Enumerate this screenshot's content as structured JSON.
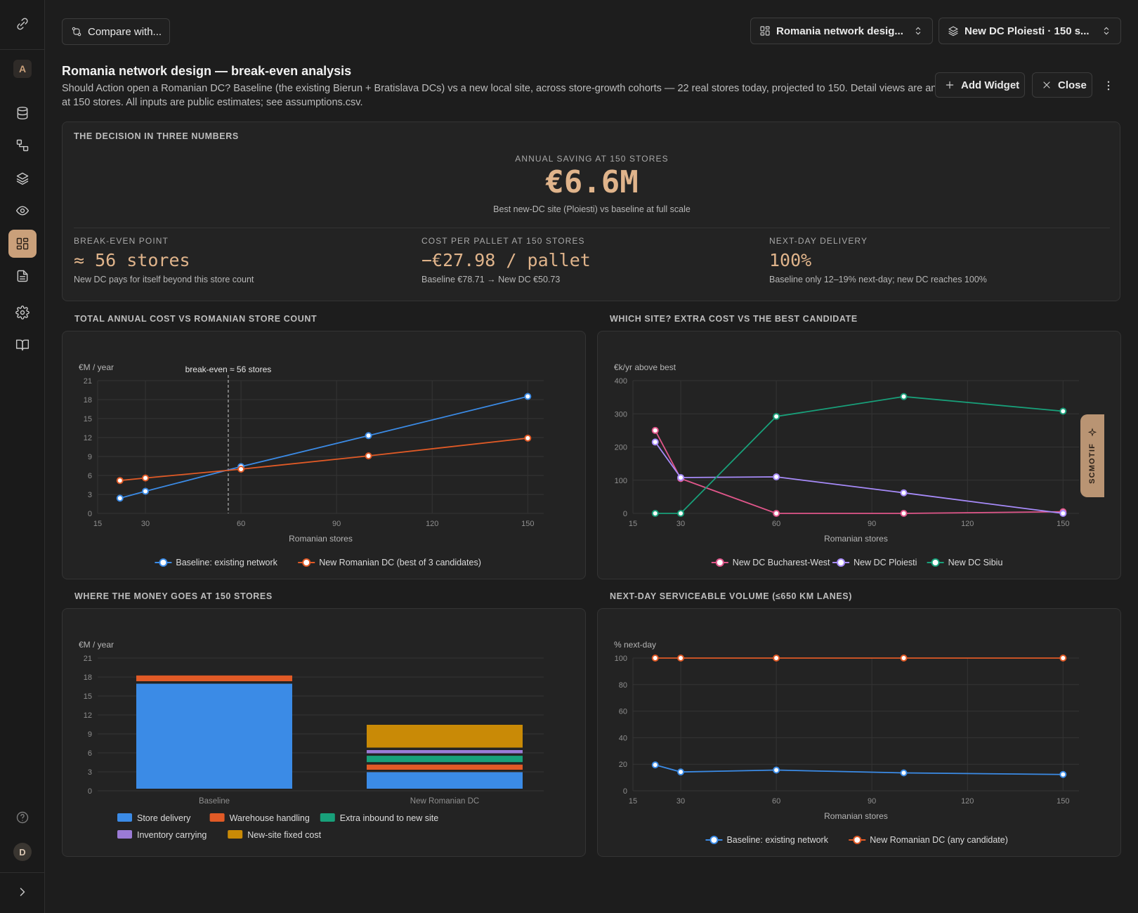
{
  "rail": {
    "workspace_badge": "A",
    "user_avatar": "D",
    "items": [
      {
        "icon": "database-icon"
      },
      {
        "icon": "flow-icon"
      },
      {
        "icon": "layers-icon"
      },
      {
        "icon": "eye-icon"
      },
      {
        "icon": "dashboard-icon",
        "active": true
      },
      {
        "icon": "document-icon"
      },
      {
        "icon": "gear-icon"
      },
      {
        "icon": "book-icon"
      }
    ]
  },
  "toolbar": {
    "compare_label": "Compare with...",
    "project_select": "Romania network desig...",
    "scenario_select": "New DC Ploiesti · 150 s...",
    "add_widget_label": "Add Widget",
    "close_label": "Close"
  },
  "page": {
    "title": "Romania network design — break-even analysis",
    "description": "Should Action open a Romanian DC? Baseline (the existing Bierun + Bratislava DCs) vs a new local site, across store-growth cohorts — 22 real stores today, projected to 150. Detail views are anchored at 150 stores. All inputs are public estimates; see assumptions.csv."
  },
  "decision": {
    "section_title": "THE DECISION IN THREE NUMBERS",
    "hero_label": "ANNUAL SAVING AT 150 STORES",
    "hero_value": "€6.6M",
    "hero_sub": "Best new-DC site (Ploiesti) vs baseline at full scale",
    "kpis": [
      {
        "label": "BREAK-EVEN POINT",
        "value": "≈ 56 stores",
        "sub": "New DC pays for itself beyond this store count"
      },
      {
        "label": "COST PER PALLET AT 150 STORES",
        "value": "−€27.98 / pallet",
        "sub": "Baseline €78.71 → New DC €50.73"
      },
      {
        "label": "NEXT-DAY DELIVERY",
        "value": "100%",
        "sub": "Baseline only 12–19% next-day; new DC reaches 100%"
      }
    ]
  },
  "feedback_tab": "SCMOTIF",
  "colors": {
    "blue": "#3b8be6",
    "orange": "#e15a26",
    "green": "#18a07a",
    "purple": "#9b7bd6",
    "pink": "#e0568a",
    "lavender": "#a78bfa",
    "gold": "#c98a06",
    "accent": "#caa07a"
  },
  "chart_data": [
    {
      "section_title": "TOTAL ANNUAL COST VS ROMANIAN STORE COUNT",
      "type": "line",
      "ylabel": "€M / year",
      "xlabel": "Romanian stores",
      "xlim": [
        15,
        155
      ],
      "xticks": [
        15,
        30,
        60,
        90,
        120,
        150
      ],
      "ylim": [
        0,
        21
      ],
      "yticks": [
        0,
        3,
        6,
        9,
        12,
        15,
        18,
        21
      ],
      "annotation": {
        "x": 56,
        "text": "break-even ≈ 56 stores"
      },
      "series": [
        {
          "name": "Baseline: existing network",
          "color": "#3b8be6",
          "x": [
            22,
            30,
            60,
            100,
            150
          ],
          "y": [
            2.4,
            3.5,
            7.4,
            12.3,
            18.5
          ]
        },
        {
          "name": "New Romanian DC (best of 3 candidates)",
          "color": "#e15a26",
          "x": [
            22,
            30,
            60,
            100,
            150
          ],
          "y": [
            5.2,
            5.6,
            7.0,
            9.1,
            11.9
          ]
        }
      ]
    },
    {
      "section_title": "WHICH SITE? EXTRA COST VS THE BEST CANDIDATE",
      "type": "line",
      "ylabel": "€k/yr above best",
      "xlabel": "Romanian stores",
      "xlim": [
        15,
        155
      ],
      "xticks": [
        15,
        30,
        60,
        90,
        120,
        150
      ],
      "ylim": [
        0,
        400
      ],
      "yticks": [
        0,
        100,
        200,
        300,
        400
      ],
      "series": [
        {
          "name": "New DC Bucharest-West",
          "color": "#e0568a",
          "x": [
            22,
            30,
            60,
            100,
            150
          ],
          "y": [
            250,
            105,
            0,
            0,
            5
          ]
        },
        {
          "name": "New DC Ploiesti",
          "color": "#a78bfa",
          "x": [
            22,
            30,
            60,
            100,
            150
          ],
          "y": [
            215,
            108,
            110,
            62,
            0
          ]
        },
        {
          "name": "New DC Sibiu",
          "color": "#18a07a",
          "x": [
            22,
            30,
            60,
            100,
            150
          ],
          "y": [
            0,
            0,
            292,
            352,
            308
          ]
        }
      ]
    },
    {
      "section_title": "WHERE THE MONEY GOES AT 150 STORES",
      "type": "bar",
      "stacked": true,
      "ylabel": "€M / year",
      "ylim": [
        0,
        21
      ],
      "yticks": [
        0,
        3,
        6,
        9,
        12,
        15,
        18,
        21
      ],
      "categories": [
        "Baseline",
        "New Romanian DC"
      ],
      "series": [
        {
          "name": "Store delivery",
          "color": "#3b8be6",
          "values": [
            17.0,
            3.0
          ]
        },
        {
          "name": "Warehouse handling",
          "color": "#e15a26",
          "values": [
            1.3,
            1.2
          ]
        },
        {
          "name": "Extra inbound to new site",
          "color": "#18a07a",
          "values": [
            0,
            1.4
          ]
        },
        {
          "name": "Inventory carrying",
          "color": "#9b7bd6",
          "values": [
            0,
            0.9
          ]
        },
        {
          "name": "New-site fixed cost",
          "color": "#c98a06",
          "values": [
            0,
            4.0
          ]
        }
      ]
    },
    {
      "section_title": "NEXT-DAY SERVICEABLE VOLUME (≤650 KM LANES)",
      "type": "line",
      "ylabel": "% next-day",
      "xlabel": "Romanian stores",
      "xlim": [
        15,
        155
      ],
      "xticks": [
        15,
        30,
        60,
        90,
        120,
        150
      ],
      "ylim": [
        0,
        100
      ],
      "yticks": [
        0,
        20,
        40,
        60,
        80,
        100
      ],
      "series": [
        {
          "name": "Baseline: existing network",
          "color": "#3b8be6",
          "x": [
            22,
            30,
            60,
            100,
            150
          ],
          "y": [
            19.5,
            14.2,
            15.6,
            13.5,
            12.3
          ]
        },
        {
          "name": "New Romanian DC (any candidate)",
          "color": "#e15a26",
          "x": [
            22,
            30,
            60,
            100,
            150
          ],
          "y": [
            100,
            100,
            100,
            100,
            100
          ]
        }
      ]
    }
  ]
}
